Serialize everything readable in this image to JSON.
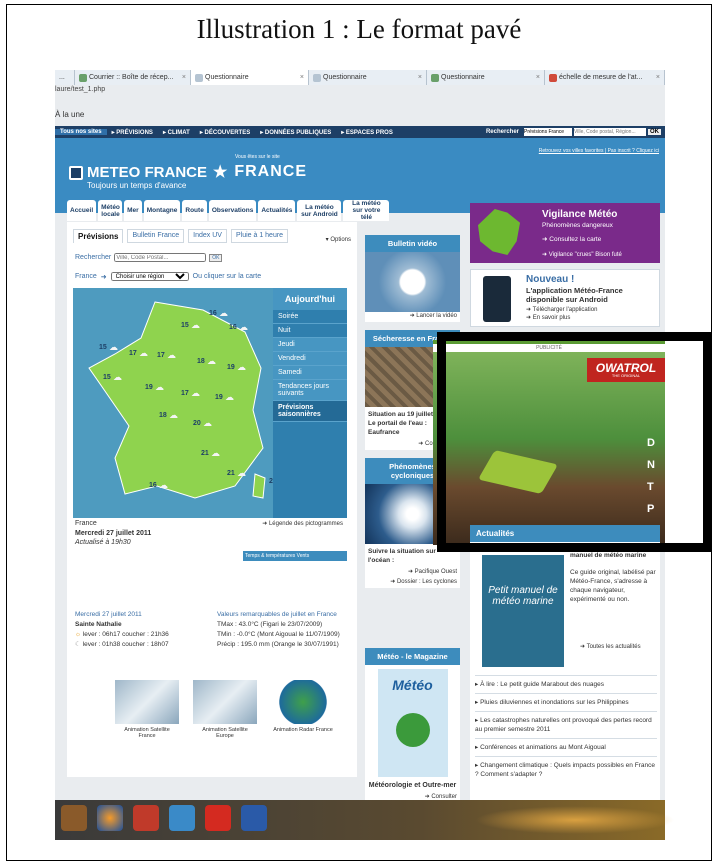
{
  "caption": "Illustration 1 : Le format pavé",
  "browser": {
    "tabs": [
      {
        "label": "...",
        "active": false
      },
      {
        "label": "Courrier :: Boîte de récep...",
        "active": false
      },
      {
        "label": "Questionnaire",
        "active": true
      },
      {
        "label": "Questionnaire",
        "active": false
      },
      {
        "label": "Questionnaire",
        "active": false
      },
      {
        "label": "échelle de mesure de l'at...",
        "active": false
      }
    ],
    "url": "laure/test_1.php"
  },
  "page": {
    "a_la_une": "À la une",
    "topbar": [
      "Tous nos sites",
      "▸ PRÉVISIONS",
      "▸ CLIMAT",
      "▸ DÉCOUVERTES",
      "▸ DONNÉES PUBLIQUES",
      "▸ ESPACES PROS"
    ],
    "search_label": "Rechercher",
    "search_select": "Prévisions France",
    "search_placeholder": "Ville, Code postal, Région...",
    "ok": "OK",
    "logo_main": "METEO FRANCE",
    "logo_sub": "Toujours un temps d'avance",
    "site_small": "Vous êtes sur le site",
    "site_big": "FRANCE",
    "meta": "Retrouvez vos villes favorites | Pas inscrit ? Cliquez ici",
    "nav": [
      "Accueil",
      "Météo locale",
      "Mer",
      "Montagne",
      "Route",
      "Observations",
      "Actualités",
      "La météo sur Android",
      "La météo sur votre télé"
    ]
  },
  "forecast": {
    "tabs": [
      "Prévisions",
      "Bulletin France",
      "Index UV",
      "Pluie à 1 heure"
    ],
    "options": "Options",
    "search_label": "Rechercher",
    "search_placeholder": "Ville, Code Postal...",
    "ok": "OK",
    "region_label": "France",
    "region_select": "Choisir une région",
    "map_link": "Ou cliquer sur la carte",
    "side_title": "Aujourd'hui",
    "side_items": [
      "Soirée",
      "Nuit",
      "Jeudi",
      "Vendredi",
      "Samedi",
      "Tendances jours suivants",
      "Prévisions saisonnières"
    ],
    "temps": [
      "16",
      "15",
      "16",
      "15",
      "17",
      "17",
      "18",
      "19",
      "15",
      "19",
      "17",
      "19",
      "18",
      "20",
      "21",
      "21",
      "20",
      "16"
    ],
    "france": "France",
    "date": "Mercredi 27 juillet 2011",
    "updated": "Actualisé à 19h30",
    "legend": "Légende des pictogrammes",
    "toggle": "Temps & températures    Vents"
  },
  "ephemeris": {
    "date": "Mercredi 27 juillet 2011",
    "saint": "Sainte Nathalie",
    "sun": "lever : 06h17   coucher : 21h36",
    "moon": "lever : 01h38   coucher : 18h07"
  },
  "records": {
    "title": "Valeurs remarquables de juillet en France",
    "tmax": "TMax : 43.0°C (Figari le 23/07/2009)",
    "tmin": "TMin : -0.0°C (Mont Aigoual le 11/07/1909)",
    "precip": "Précip : 195.0 mm (Orange le 30/07/1991)"
  },
  "satellites": [
    "Animation Satellite France",
    "Animation Satellite Europe",
    "Animation Radar France"
  ],
  "col2": {
    "video_title": "Bulletin vidéo",
    "video_link": "Lancer la vidéo",
    "drought_title": "Sécheresse en France",
    "drought_text1": "Situation au 19 juillet",
    "drought_text2": "Le portail de l'eau : Eaufrance",
    "drought_link": "Consulter le",
    "cyclone_title": "Phénomènes cycloniques",
    "cyclone_text": "Suivre la situation sur l'océan :",
    "cyclone_pac": "Pacifique Ouest",
    "cyclone_dossier": "Dossier : Les cyclones",
    "mag_title": "Météo - le Magazine",
    "mag_cover": "Météo",
    "mag_text": "Météorologie et Outre-mer",
    "mag_link": "Consulter"
  },
  "vigilance": {
    "title": "Vigilance Météo",
    "sub": "Phénomènes dangereux",
    "link": "Consultez la carte",
    "links2": "Vigilance \"crues\"   Bison futé"
  },
  "android": {
    "new": "Nouveau !",
    "text": "L'application Météo-France disponible sur Android",
    "l1": "Télécharger l'application",
    "l2": "En savoir plus"
  },
  "ad": {
    "label": "PUBLICITÉ",
    "brand": "OWATROL",
    "brand_sub": "THE ORIGINAL"
  },
  "news": {
    "title": "Actualités",
    "book": "Petit manuel de météo marine",
    "head": "manuel de météo marine",
    "body": "Ce guide original, labélisé par Météo-France, s'adresse à chaque navigateur, expérimenté ou non.",
    "all": "Toutes les actualités",
    "items": [
      "À lire : Le petit guide Marabout des nuages",
      "Pluies diluviennes et inondations sur les Philippines",
      "Les catastrophes naturelles ont provoqué des pertes record au premier semestre 2011",
      "Conférences et animations au Mont Aigoual",
      "Changement climatique : Quels impacts possibles en France ? Comment s'adapter ?"
    ]
  },
  "taskbar_icons": [
    "library-icon",
    "firefox-icon",
    "presentation-icon",
    "network-icon",
    "pdf-icon",
    "word-icon"
  ]
}
